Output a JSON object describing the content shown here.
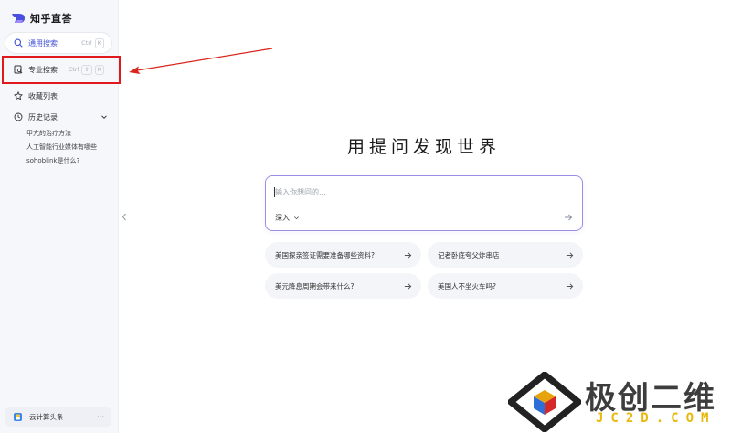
{
  "app": {
    "name": "知乎直答"
  },
  "sidebar": {
    "general_search": {
      "label": "通用搜索",
      "shortcut": [
        "Ctrl",
        "K"
      ]
    },
    "pro_search": {
      "label": "专业搜索",
      "shortcut": [
        "Ctrl",
        "⇧",
        "K"
      ]
    },
    "favorites": {
      "label": "收藏列表"
    },
    "history": {
      "label": "历史记录",
      "items": [
        "甲亢的治疗方法",
        "人工智能行业媒体有哪些",
        "sohoblink是什么?"
      ]
    },
    "user": {
      "name": "云计算头条",
      "more": "···"
    }
  },
  "main": {
    "title": "用提问发现世界",
    "search": {
      "placeholder": "输入你想问的...",
      "mode_label": "深入"
    },
    "suggestions": [
      "美国探亲签证需要准备哪些资料?",
      "记者卧底夸父炸串店",
      "美元降息周期会带来什么?",
      "美国人不坐火车吗?"
    ]
  },
  "watermark": {
    "title": "极创二维",
    "subtitle": "JC2D.COM"
  },
  "colors": {
    "accent": "#3f51d8",
    "search_border": "#9a8fe6",
    "annotation": "#e0191d",
    "watermark_gold": "#e8b80c"
  }
}
